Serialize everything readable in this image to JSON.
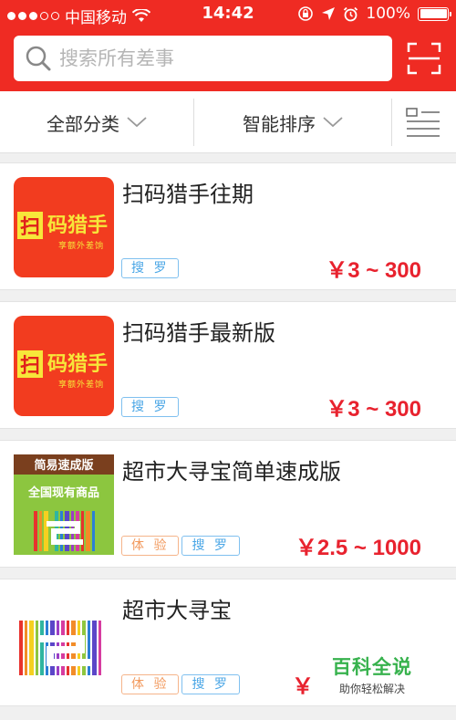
{
  "status_bar": {
    "carrier": "中国移动",
    "time": "14:42",
    "battery": "100%"
  },
  "search": {
    "placeholder": "搜索所有差事"
  },
  "filters": {
    "category": "全部分类",
    "sort": "智能排序"
  },
  "items": [
    {
      "title": "扫码猎手往期",
      "tags": [
        "搜 罗"
      ],
      "price": "￥3 ~ 300",
      "thumb": {
        "main": "码猎手",
        "sub": "享额外差饷"
      }
    },
    {
      "title": "扫码猎手最新版",
      "tags": [
        "搜 罗"
      ],
      "price": "￥3 ~ 300",
      "thumb": {
        "main": "码猎手",
        "sub": "享额外差饷"
      }
    },
    {
      "title": "超市大寻宝简单速成版",
      "tags": [
        "体 验",
        "搜 罗"
      ],
      "price": "￥2.5 ~ 1000",
      "thumb": {
        "top": "简易速成版",
        "mid": "全国现有商品"
      }
    },
    {
      "title": "超市大寻宝",
      "tags": [
        "体 验",
        "搜 罗"
      ],
      "price": "￥"
    }
  ],
  "thumb_icon_char": "扫",
  "watermark": {
    "title": "百科全说",
    "subtitle": "助你轻松解决"
  },
  "colors": {
    "brand_red": "#ef2b23",
    "price_red": "#e8222e",
    "tag_blue": "#4aa6e6",
    "tag_orange": "#f29a5e",
    "watermark_green": "#37b24d"
  }
}
